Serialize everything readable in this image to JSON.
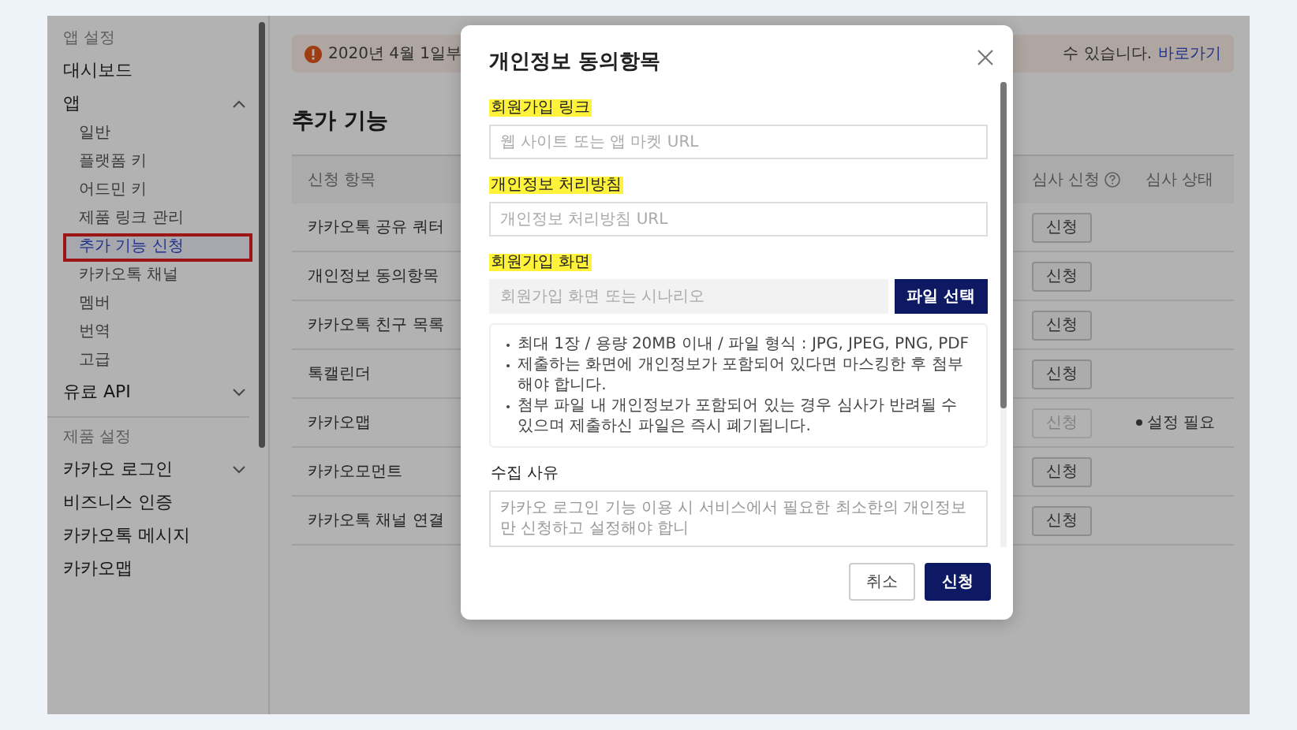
{
  "sidebar": {
    "sections": [
      {
        "title": "앱 설정",
        "items": [
          {
            "label": "대시보드",
            "selected": false
          },
          {
            "label": "앱",
            "selected": false,
            "expanded": true,
            "children": [
              {
                "label": "일반",
                "selected": false
              },
              {
                "label": "플랫폼 키",
                "selected": false
              },
              {
                "label": "어드민 키",
                "selected": false
              },
              {
                "label": "제품 링크 관리",
                "selected": false
              },
              {
                "label": "추가 기능 신청",
                "selected": true
              },
              {
                "label": "카카오톡 채널",
                "selected": false
              },
              {
                "label": "멤버",
                "selected": false
              },
              {
                "label": "번역",
                "selected": false
              },
              {
                "label": "고급",
                "selected": false
              }
            ]
          },
          {
            "label": "유료 API",
            "selected": false,
            "expanded": false
          }
        ]
      },
      {
        "title": "제품 설정",
        "items": [
          {
            "label": "카카오 로그인",
            "selected": false,
            "expanded": false
          },
          {
            "label": "비즈니스 인증",
            "selected": false
          },
          {
            "label": "카카오톡 메시지",
            "selected": false
          },
          {
            "label": "카카오맵",
            "selected": false
          }
        ]
      }
    ]
  },
  "banner": {
    "text": "2020년 4월 1일부",
    "text_end": "수 있습니다.",
    "link": "바로가기"
  },
  "heading": "추가 기능",
  "table": {
    "columns": [
      "신청 항목",
      "심사 신청",
      "심사 상태"
    ],
    "rows": [
      {
        "name": "카카오톡 공유 쿼터",
        "button": "신청",
        "disabled": false,
        "status": ""
      },
      {
        "name": "개인정보 동의항목",
        "button": "신청",
        "disabled": false,
        "status": ""
      },
      {
        "name": "카카오톡 친구 목록",
        "button": "신청",
        "disabled": false,
        "status": ""
      },
      {
        "name": "톡캘린더",
        "button": "신청",
        "disabled": false,
        "status": ""
      },
      {
        "name": "카카오맵",
        "button": "신청",
        "disabled": true,
        "status": "설정 필요"
      },
      {
        "name": "카카오모먼트",
        "button": "신청",
        "disabled": false,
        "status": ""
      },
      {
        "name": "카카오톡 채널 연결",
        "button": "신청",
        "disabled": false,
        "status": ""
      }
    ]
  },
  "modal": {
    "title": "개인정보 동의항목",
    "fields": [
      {
        "kind": "text",
        "label": "회원가입 링크",
        "highlighted": true,
        "placeholder": "웹 사이트 또는 앱 마켓 URL"
      },
      {
        "kind": "text",
        "label": "개인정보 처리방침",
        "highlighted": true,
        "placeholder": "개인정보 처리방침 URL"
      },
      {
        "kind": "file",
        "label": "회원가입 화면",
        "highlighted": true,
        "placeholder": "회원가입 화면 또는 시나리오",
        "button": "파일 선택",
        "notes": [
          "최대 1장 / 용량 20MB 이내 / 파일 형식 : JPG, JPEG, PNG, PDF",
          "제출하는 화면에 개인정보가 포함되어 있다면 마스킹한 후 첨부해야 합니다.",
          "첨부 파일 내 개인정보가 포함되어 있는 경우 심사가 반려될 수 있으며 제출하신 파일은 즉시 폐기됩니다."
        ]
      },
      {
        "kind": "textarea",
        "label": "수집 사유",
        "highlighted": false,
        "placeholder": "카카오 로그인 기능 이용 시 서비스에서 필요한 최소한의 개인정보만 신청하고 설정해야 합니"
      }
    ],
    "buttons": [
      {
        "label": "취소",
        "primary": false
      },
      {
        "label": "신청",
        "primary": true
      }
    ]
  }
}
